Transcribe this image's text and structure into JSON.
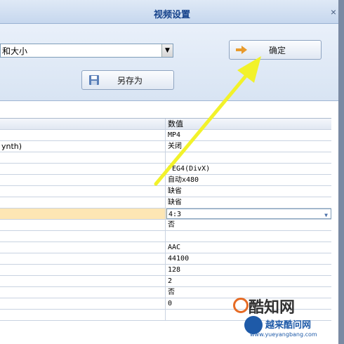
{
  "window": {
    "title": "视频设置",
    "close_glyph": "×"
  },
  "preset_combo": {
    "value": "和大小",
    "arrow_glyph": "▼"
  },
  "buttons": {
    "ok_label": "确定",
    "save_as_label": "另存为"
  },
  "table": {
    "value_header": "数值",
    "rows": [
      {
        "name": "",
        "value": "MP4"
      },
      {
        "name": "ynth)",
        "value": "关闭"
      },
      {
        "name": "",
        "value": ""
      },
      {
        "name": "",
        "value": "PEG4(DivX)"
      },
      {
        "name": "",
        "value": "自动x480"
      },
      {
        "name": "",
        "value": "缺省"
      },
      {
        "name": "",
        "value": "缺省"
      },
      {
        "name": "",
        "value": "4:3"
      },
      {
        "name": "",
        "value": "否"
      },
      {
        "name": "",
        "value": ""
      },
      {
        "name": "",
        "value": "AAC"
      },
      {
        "name": "",
        "value": "44100"
      },
      {
        "name": "",
        "value": "128"
      },
      {
        "name": "",
        "value": "2"
      },
      {
        "name": "",
        "value": "否"
      },
      {
        "name": "",
        "value": "0"
      },
      {
        "name": "",
        "value": ""
      }
    ]
  },
  "watermark": {
    "brand": "酷知网",
    "brand2": "越来酷问网",
    "url": "www.yueyangbang.com"
  },
  "colors": {
    "titlebar": "#c6d7ee",
    "highlight_row": "#fde6b4",
    "arrow": "#f2f22a"
  }
}
